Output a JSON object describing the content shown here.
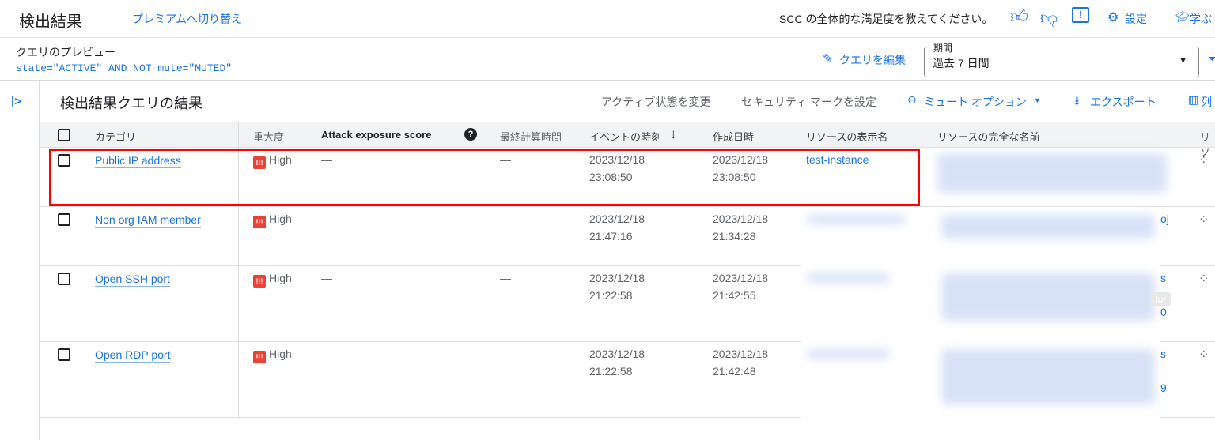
{
  "header": {
    "title": "検出結果",
    "premium_link": "プレミアムへ切り替え",
    "feedback_prompt": "SCC の全体的な満足度を教えてください。",
    "settings": "設定",
    "learn": "学ぶ"
  },
  "query": {
    "label": "クエリのプレビュー",
    "text": "state=\"ACTIVE\" AND NOT mute=\"MUTED\"",
    "edit": "クエリを編集",
    "period_label": "期間",
    "period_value": "過去 7 日間"
  },
  "results": {
    "title": "検出結果クエリの結果",
    "change_active": "アクティブ状態を変更",
    "set_mark": "セキュリティ マークを設定",
    "mute_options": "ミュート オプション",
    "export": "エクスポート",
    "columns": "列"
  },
  "table": {
    "headers": {
      "category": "カテゴリ",
      "severity": "重大度",
      "attack": "Attack exposure score",
      "last_calc": "最終計算時間",
      "event_time": "イベントの時刻",
      "created": "作成日時",
      "display_name": "リソースの表示名",
      "full_name": "リソースの完全な名前",
      "last": "リソ"
    },
    "rows": [
      {
        "category": "Public IP address",
        "severity": "High",
        "attack": "—",
        "last_calc": "—",
        "event_date": "2023/12/18",
        "event_time": "23:08:50",
        "created_date": "2023/12/18",
        "created_time": "23:08:50",
        "display_name": "test-instance",
        "frag1": "",
        "frag2": ""
      },
      {
        "category": "Non org IAM member",
        "severity": "High",
        "attack": "—",
        "last_calc": "—",
        "event_date": "2023/12/18",
        "event_time": "21:47:16",
        "created_date": "2023/12/18",
        "created_time": "21:34:28",
        "display_name": "",
        "frag1": "oj",
        "frag2": ""
      },
      {
        "category": "Open SSH port",
        "severity": "High",
        "attack": "—",
        "last_calc": "—",
        "event_date": "2023/12/18",
        "event_time": "21:22:58",
        "created_date": "2023/12/18",
        "created_time": "21:42:55",
        "display_name": "",
        "frag1": "s",
        "frag2": "0"
      },
      {
        "category": "Open RDP port",
        "severity": "High",
        "attack": "—",
        "last_calc": "—",
        "event_date": "2023/12/18",
        "event_time": "21:22:58",
        "created_date": "2023/12/18",
        "created_time": "21:42:48",
        "display_name": "",
        "frag1": "s",
        "frag2": "9"
      }
    ],
    "tooltip": "lur"
  },
  "colors": {
    "accent": "#1a73e8",
    "highlight": "#ff0000",
    "severity_high": "#ea4335"
  }
}
